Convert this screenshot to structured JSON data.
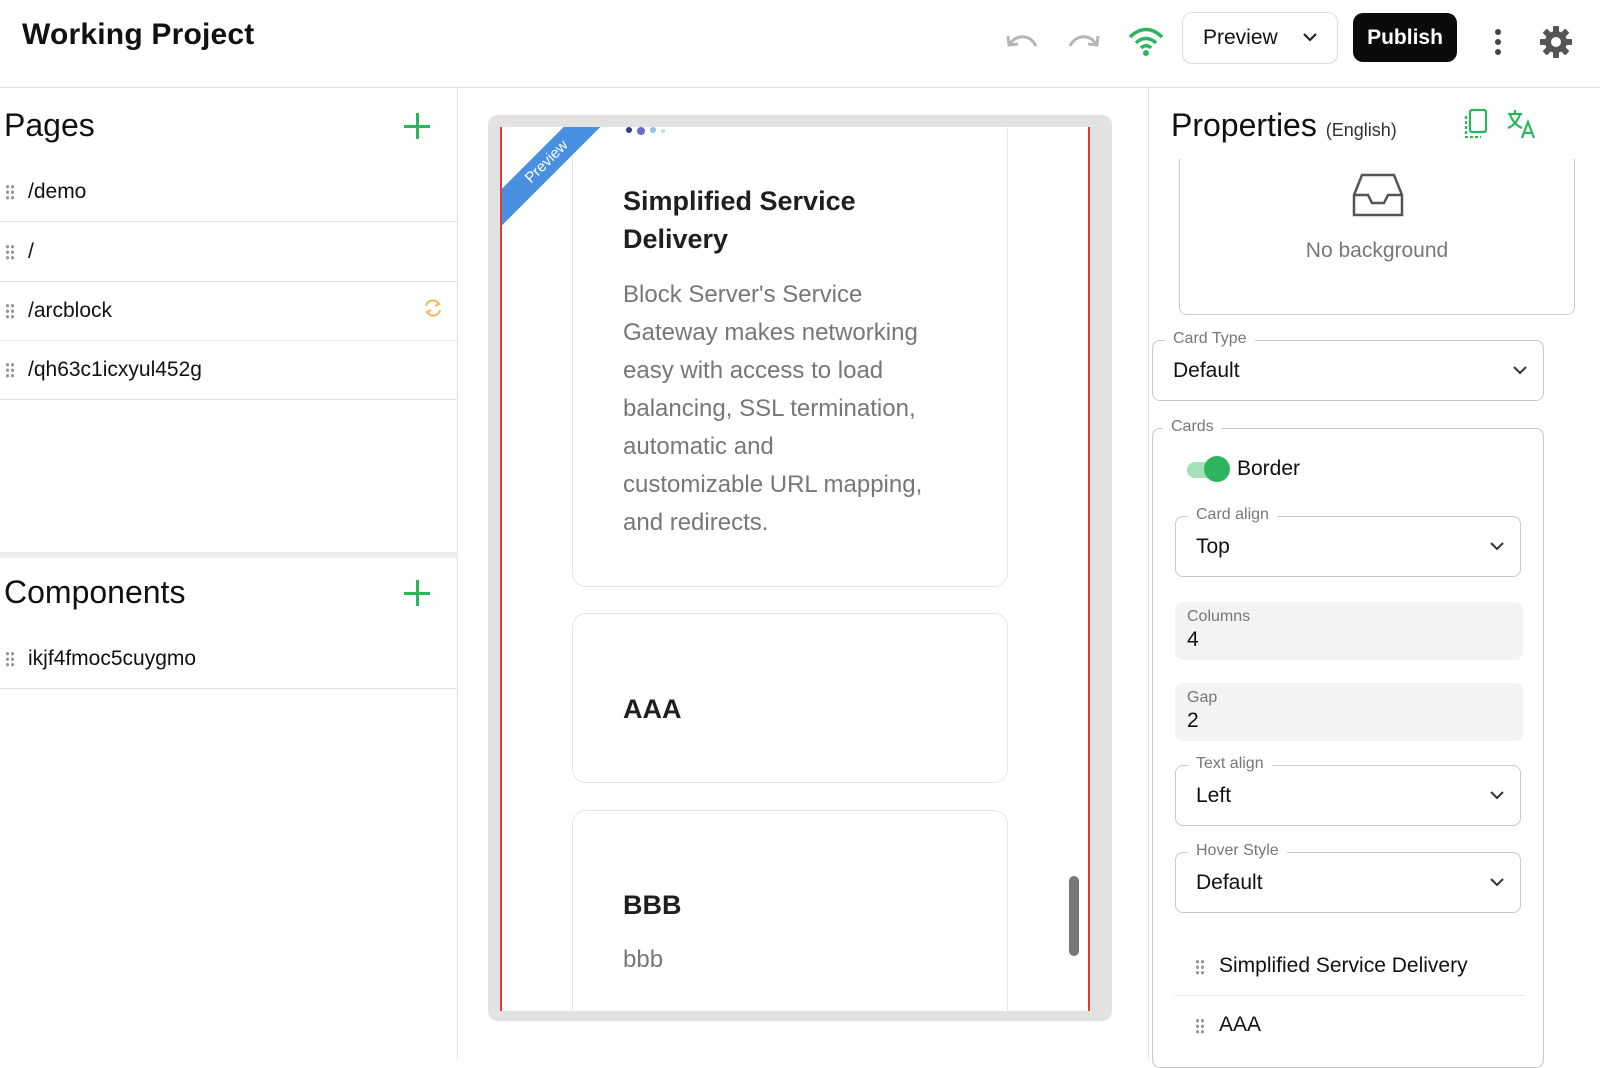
{
  "header": {
    "title": "Working Project",
    "preview_label": "Preview",
    "publish_label": "Publish",
    "icons": [
      "undo-icon",
      "redo-icon",
      "wifi-icon",
      "more-vertical-icon",
      "gear-icon"
    ],
    "accent_color": "#2db55d"
  },
  "pages": {
    "title": "Pages",
    "items": [
      {
        "label": "/demo"
      },
      {
        "label": "/"
      },
      {
        "label": "/arcblock"
      },
      {
        "label": "/qh63c1icxyul452g"
      }
    ]
  },
  "components": {
    "title": "Components",
    "items": [
      {
        "label": "ikjf4fmoc5cuygmo"
      }
    ]
  },
  "canvas": {
    "ribbon": "Preview",
    "cards": [
      {
        "title_line1": "Simplified Service",
        "title_line2": "Delivery",
        "desc_lines": [
          "Block Server's Service",
          "Gateway makes networking",
          "easy with access to load",
          "balancing, SSL termination,",
          "automatic and",
          "customizable URL mapping,",
          "and redirects."
        ]
      },
      {
        "title": "AAA"
      },
      {
        "title": "BBB",
        "desc": "bbb"
      }
    ]
  },
  "properties": {
    "title": "Properties",
    "language": "(English)",
    "background_label": "No background",
    "card_type": {
      "label": "Card Type",
      "value": "Default"
    },
    "cards_group": {
      "label": "Cards"
    },
    "border": {
      "label": "Border",
      "enabled": true
    },
    "card_align": {
      "label": "Card align",
      "value": "Top"
    },
    "columns": {
      "label": "Columns",
      "value": "4"
    },
    "gap": {
      "label": "Gap",
      "value": "2"
    },
    "text_align": {
      "label": "Text align",
      "value": "Left"
    },
    "hover_style": {
      "label": "Hover Style",
      "value": "Default"
    },
    "card_list": [
      {
        "label": "Simplified Service Delivery"
      },
      {
        "label": "AAA"
      }
    ]
  }
}
